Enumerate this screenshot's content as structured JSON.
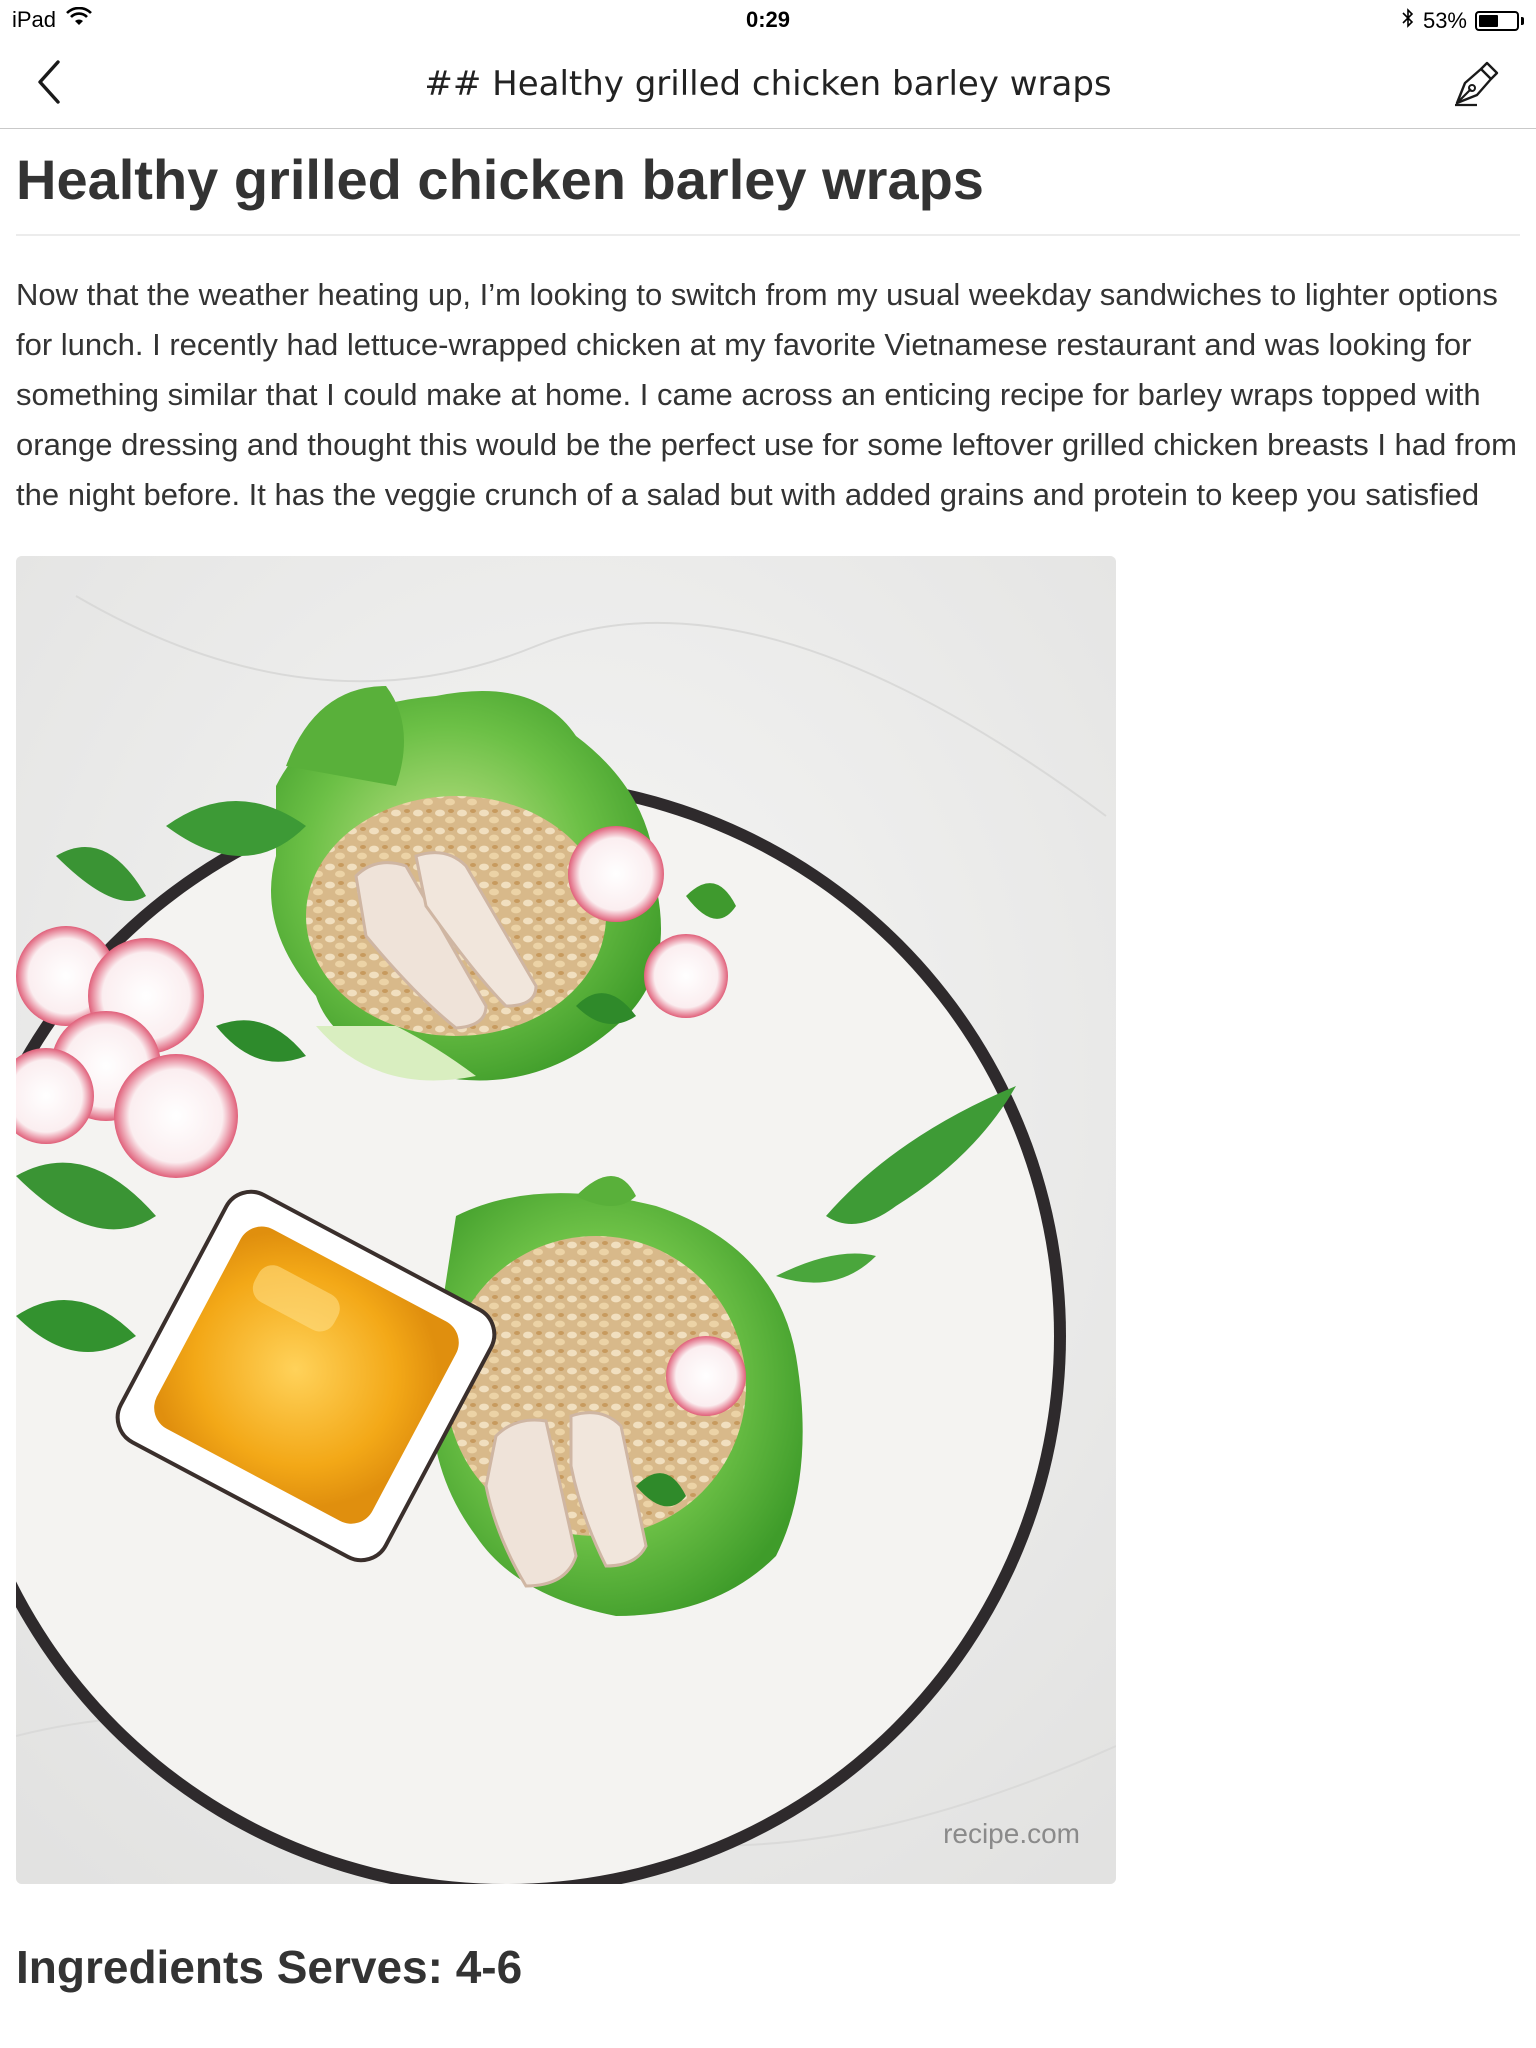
{
  "status_bar": {
    "device": "iPad",
    "time": "0:29",
    "battery_percent_label": "53%",
    "battery_level": 0.53,
    "icons": [
      "wifi-icon",
      "bluetooth-icon",
      "battery-icon"
    ]
  },
  "nav": {
    "title": "## Healthy grilled chicken barley wraps",
    "back_icon": "chevron-left-icon",
    "edit_icon": "pen-nib-icon"
  },
  "article": {
    "title": "Healthy grilled chicken barley wraps",
    "body": "Now that the weather heating up, I’m looking to switch from my usual weekday sandwiches to lighter options for lunch. I recently had lettuce-wrapped chicken at my favorite Vietnamese restaurant and was looking for something similar that I could make at home. I came across an enticing recipe for barley wraps topped with orange dressing and thought this would be the perfect use for some leftover grilled chicken breasts I had from the night before. It has the veggie crunch of a salad but with added grains and protein to keep you satisfied",
    "photo_watermark": "recipe.com",
    "ingredients_heading": "Ingredients Serves: 4-6"
  },
  "colors": {
    "lettuce": "#5fb63a",
    "dressing": "#f3a817",
    "plate_rim": "#2e2a2c",
    "radish": "#e8a9b4"
  }
}
